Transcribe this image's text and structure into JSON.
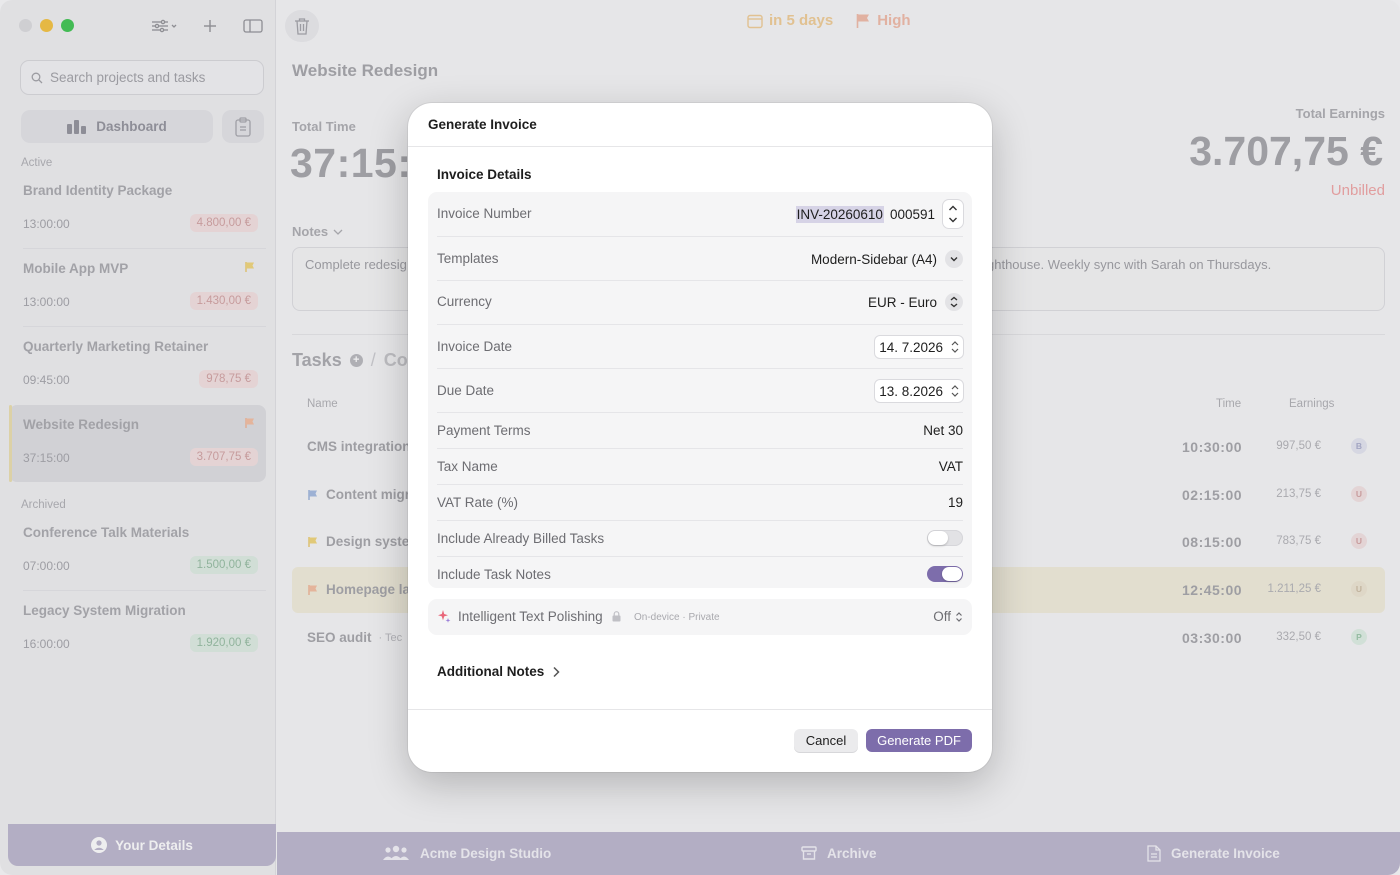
{
  "sidebar": {
    "search_placeholder": "Search projects and tasks",
    "dashboard_label": "Dashboard",
    "active_label": "Active",
    "archived_label": "Archived",
    "active_projects": [
      {
        "name": "Brand Identity Package",
        "time": "13:00:00",
        "amount": "4.800,00 €",
        "flag": ""
      },
      {
        "name": "Mobile App MVP",
        "time": "13:00:00",
        "amount": "1.430,00 €",
        "flag": "yellow"
      },
      {
        "name": "Quarterly Marketing Retainer",
        "time": "09:45:00",
        "amount": "978,75 €",
        "flag": ""
      },
      {
        "name": "Website Redesign",
        "time": "37:15:00",
        "amount": "3.707,75 €",
        "flag": "orange"
      }
    ],
    "archived_projects": [
      {
        "name": "Conference Talk Materials",
        "time": "07:00:00",
        "amount": "1.500,00 €"
      },
      {
        "name": "Legacy System Migration",
        "time": "16:00:00",
        "amount": "1.920,00 €"
      }
    ],
    "your_details_label": "Your Details"
  },
  "toolbar": {
    "due_label": "in 5 days",
    "priority_label": "High"
  },
  "main": {
    "title": "Website Redesign",
    "total_time_label": "Total Time",
    "total_time_value": "37:15:0",
    "total_earnings_label": "Total Earnings",
    "total_earnings_value": "3.707,75 €",
    "earnings_status": "Unbilled",
    "notes_label": "Notes",
    "notes_left": "Complete redesig",
    "notes_right": "ghthouse. Weekly sync with Sarah on Thursdays.",
    "tasks_label": "Tasks",
    "costs_label": "Cos",
    "columns": {
      "name": "Name",
      "time": "Time",
      "earnings": "Earnings"
    },
    "tasks": [
      {
        "name": "CMS integration",
        "meta": "",
        "flag": "",
        "time": "10:30:00",
        "earnings": "997,50 €",
        "avatar": "B"
      },
      {
        "name": "Content migr",
        "meta": "",
        "flag": "blue",
        "time": "02:15:00",
        "earnings": "213,75 €",
        "avatar": "U"
      },
      {
        "name": "Design syste",
        "meta": "",
        "flag": "yellow",
        "time": "08:15:00",
        "earnings": "783,75 €",
        "avatar": "U"
      },
      {
        "name": "Homepage la",
        "meta": "",
        "flag": "orange",
        "time": "12:45:00",
        "earnings": "1.211,25 €",
        "avatar": "U"
      },
      {
        "name": "SEO audit",
        "meta": "·  Tec",
        "flag": "",
        "time": "03:30:00",
        "earnings": "332,50 €",
        "avatar": "P"
      }
    ],
    "bottom_bar": {
      "client": "Acme Design Studio",
      "archive": "Archive",
      "generate": "Generate Invoice"
    }
  },
  "dialog": {
    "title": "Generate Invoice",
    "section_title": "Invoice Details",
    "invoice_number_label": "Invoice Number",
    "invoice_number_prefix": "INV-20260610",
    "invoice_number_suffix": "000591",
    "templates_label": "Templates",
    "templates_value": "Modern-Sidebar (A4)",
    "currency_label": "Currency",
    "currency_value": "EUR - Euro",
    "invoice_date_label": "Invoice Date",
    "invoice_date_value": "14.  7.2026",
    "due_date_label": "Due Date",
    "due_date_value": "13.  8.2026",
    "payment_terms_label": "Payment Terms",
    "payment_terms_value": "Net 30",
    "tax_name_label": "Tax Name",
    "tax_name_value": "VAT",
    "vat_rate_label": "VAT Rate (%)",
    "vat_rate_value": "19",
    "include_billed_label": "Include Already Billed Tasks",
    "include_billed_on": false,
    "include_notes_label": "Include Task Notes",
    "include_notes_on": true,
    "itp_label": "Intelligent Text Polishing",
    "itp_meta": "On-device · Private",
    "itp_value": "Off",
    "additional_notes_label": "Additional Notes",
    "cancel_label": "Cancel",
    "generate_label": "Generate PDF"
  },
  "colors": {
    "accent": "#7d6dab",
    "bottom_bar": "#b7b1cb",
    "unbilled": "#ef9d9d"
  }
}
